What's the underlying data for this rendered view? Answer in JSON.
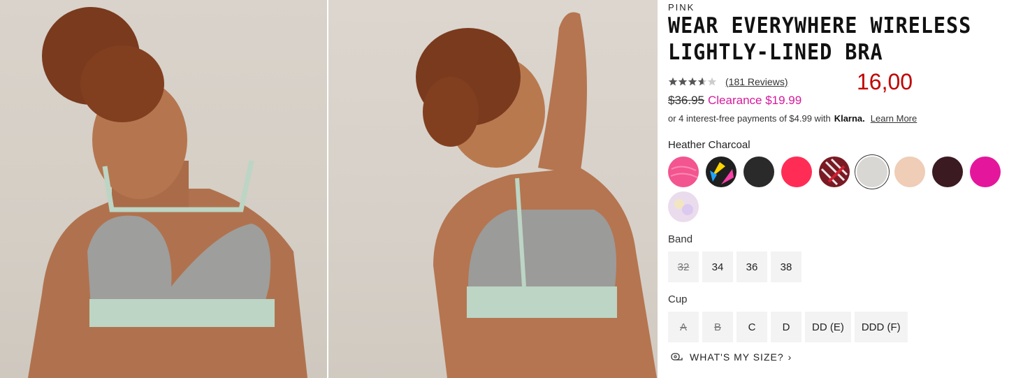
{
  "product": {
    "brand": "PINK",
    "title_line1": "WEAR EVERYWHERE WIRELESS",
    "title_line2": "LIGHTLY-LINED BRA",
    "rating": 3.8,
    "reviews": "(181 Reviews)",
    "overlay_price": "16,00",
    "original_price": "$36.95",
    "sale_price": "Clearance $19.99",
    "klarna_text": "or 4 interest-free payments of $4.99 with",
    "klarna_brand": "Klarna.",
    "klarna_link": "Learn More"
  },
  "color": {
    "selected_name": "Heather Charcoal",
    "swatches": [
      {
        "name": "pink",
        "color": "#f2558f"
      },
      {
        "name": "multicolor-print",
        "color": "#1f1f1f"
      },
      {
        "name": "black",
        "color": "#2a2a2a"
      },
      {
        "name": "coral-red",
        "color": "#ff2d55"
      },
      {
        "name": "plaid",
        "color": "#7a1a24"
      },
      {
        "name": "heather-gray",
        "color": "#d9d7d3"
      },
      {
        "name": "nude",
        "color": "#efcdb6"
      },
      {
        "name": "burgundy",
        "color": "#3c1a22"
      },
      {
        "name": "magenta",
        "color": "#e4179c"
      },
      {
        "name": "pastel-iridescent",
        "color": "#eadcec"
      }
    ]
  },
  "band": {
    "label": "Band",
    "sizes": [
      "32",
      "34",
      "36",
      "38"
    ]
  },
  "cup": {
    "label": "Cup",
    "sizes": [
      "A",
      "B",
      "C",
      "D",
      "DD (E)",
      "DDD (F)"
    ]
  },
  "size_help": "WHAT'S MY SIZE?"
}
